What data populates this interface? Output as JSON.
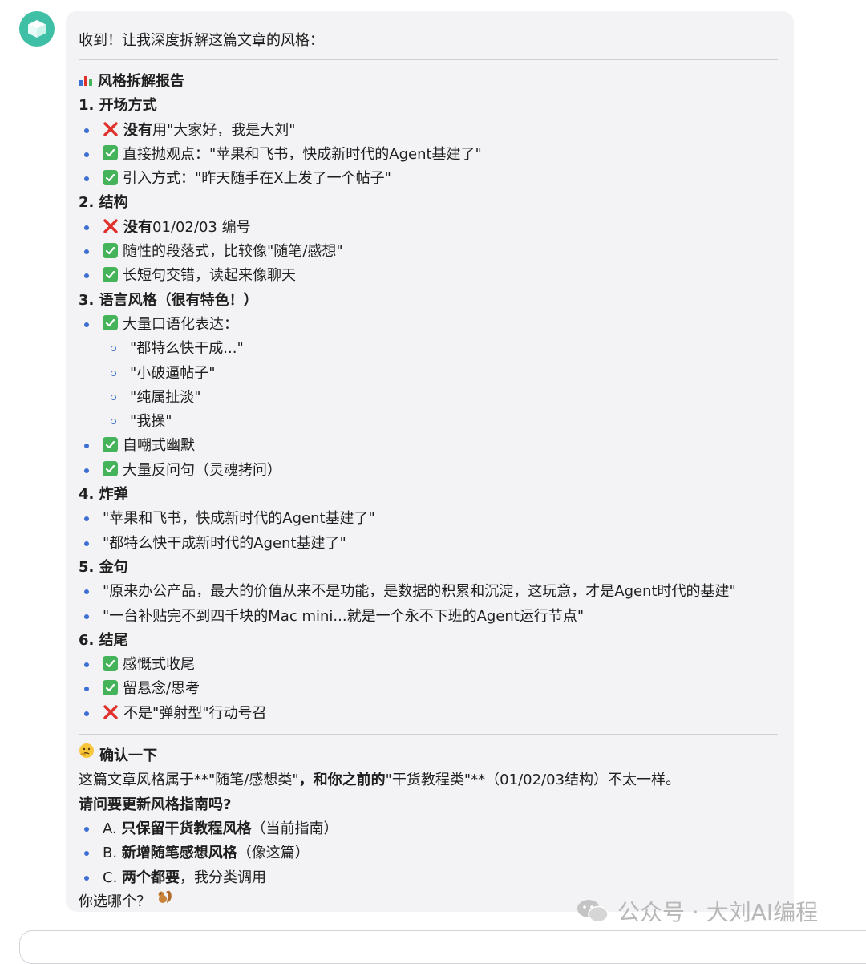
{
  "message": {
    "intro": "收到！让我深度拆解这篇文章的风格：",
    "report_title": "风格拆解报告",
    "sections": [
      {
        "heading": "1. 开场方式",
        "items": [
          {
            "icon": "cross-mark-icon",
            "bold": "没有",
            "text": "用\"大家好，我是大刘\""
          },
          {
            "icon": "check-mark-icon",
            "bold": "",
            "text": "直接抛观点：\"苹果和飞书，快成新时代的Agent基建了\""
          },
          {
            "icon": "check-mark-icon",
            "bold": "",
            "text": "引入方式：\"昨天随手在X上发了一个帖子\""
          }
        ]
      },
      {
        "heading": "2. 结构",
        "items": [
          {
            "icon": "cross-mark-icon",
            "bold": "没有",
            "text": "01/02/03 编号"
          },
          {
            "icon": "check-mark-icon",
            "bold": "",
            "text": "随性的段落式，比较像\"随笔/感想\""
          },
          {
            "icon": "check-mark-icon",
            "bold": "",
            "text": "长短句交错，读起来像聊天"
          }
        ]
      },
      {
        "heading": "3. 语言风格（很有特色！）",
        "items": [
          {
            "icon": "check-mark-icon",
            "bold": "",
            "text": "大量口语化表达：",
            "subitems": [
              "\"都特么快干成...\"",
              "\"小破逼帖子\"",
              "\"纯属扯淡\"",
              "\"我操\""
            ]
          },
          {
            "icon": "check-mark-icon",
            "bold": "",
            "text": "自嘲式幽默"
          },
          {
            "icon": "check-mark-icon",
            "bold": "",
            "text": "大量反问句（灵魂拷问）"
          }
        ]
      },
      {
        "heading": "4. 炸弹",
        "items": [
          {
            "icon": "",
            "bold": "",
            "text": "\"苹果和飞书，快成新时代的Agent基建了\""
          },
          {
            "icon": "",
            "bold": "",
            "text": "\"都特么快干成新时代的Agent基建了\""
          }
        ]
      },
      {
        "heading": "5. 金句",
        "items": [
          {
            "icon": "",
            "bold": "",
            "text": "\"原来办公产品，最大的价值从来不是功能，是数据的积累和沉淀，这玩意，才是Agent时代的基建\""
          },
          {
            "icon": "",
            "bold": "",
            "text": "\"一台补贴完不到四千块的Mac mini...就是一个永不下班的Agent运行节点\""
          }
        ]
      },
      {
        "heading": "6. 结尾",
        "items": [
          {
            "icon": "check-mark-icon",
            "bold": "",
            "text": "感慨式收尾"
          },
          {
            "icon": "check-mark-icon",
            "bold": "",
            "text": "留悬念/思考"
          },
          {
            "icon": "cross-mark-icon",
            "bold": "",
            "text": "不是\"弹射型\"行动号召"
          }
        ]
      }
    ],
    "confirm": {
      "title": "确认一下",
      "para_part1": "这篇文章风格属于**\"随笔/感想类\"",
      "para_part2": "，和你之前的",
      "para_part3": "\"干货教程类\"**（01/02/03结构）不太一样。",
      "question": "请问要更新风格指南吗?",
      "options": [
        {
          "prefix": "A. ",
          "bold": "只保留干货教程风格",
          "rest": "（当前指南）"
        },
        {
          "prefix": "B. ",
          "bold": "新增随笔感想风格",
          "rest": "（像这篇）"
        },
        {
          "prefix": "C. ",
          "bold": "两个都要",
          "rest": "，我分类调用"
        }
      ],
      "ending": "你选哪个？"
    }
  },
  "watermark": "公众号 · 大刘AI编程",
  "colors": {
    "bubble_bg": "#f3f3f5",
    "bullet": "#3b6fd4",
    "check": "#44b35a",
    "cross": "#e0302c",
    "avatar": "#3fc0a6"
  }
}
